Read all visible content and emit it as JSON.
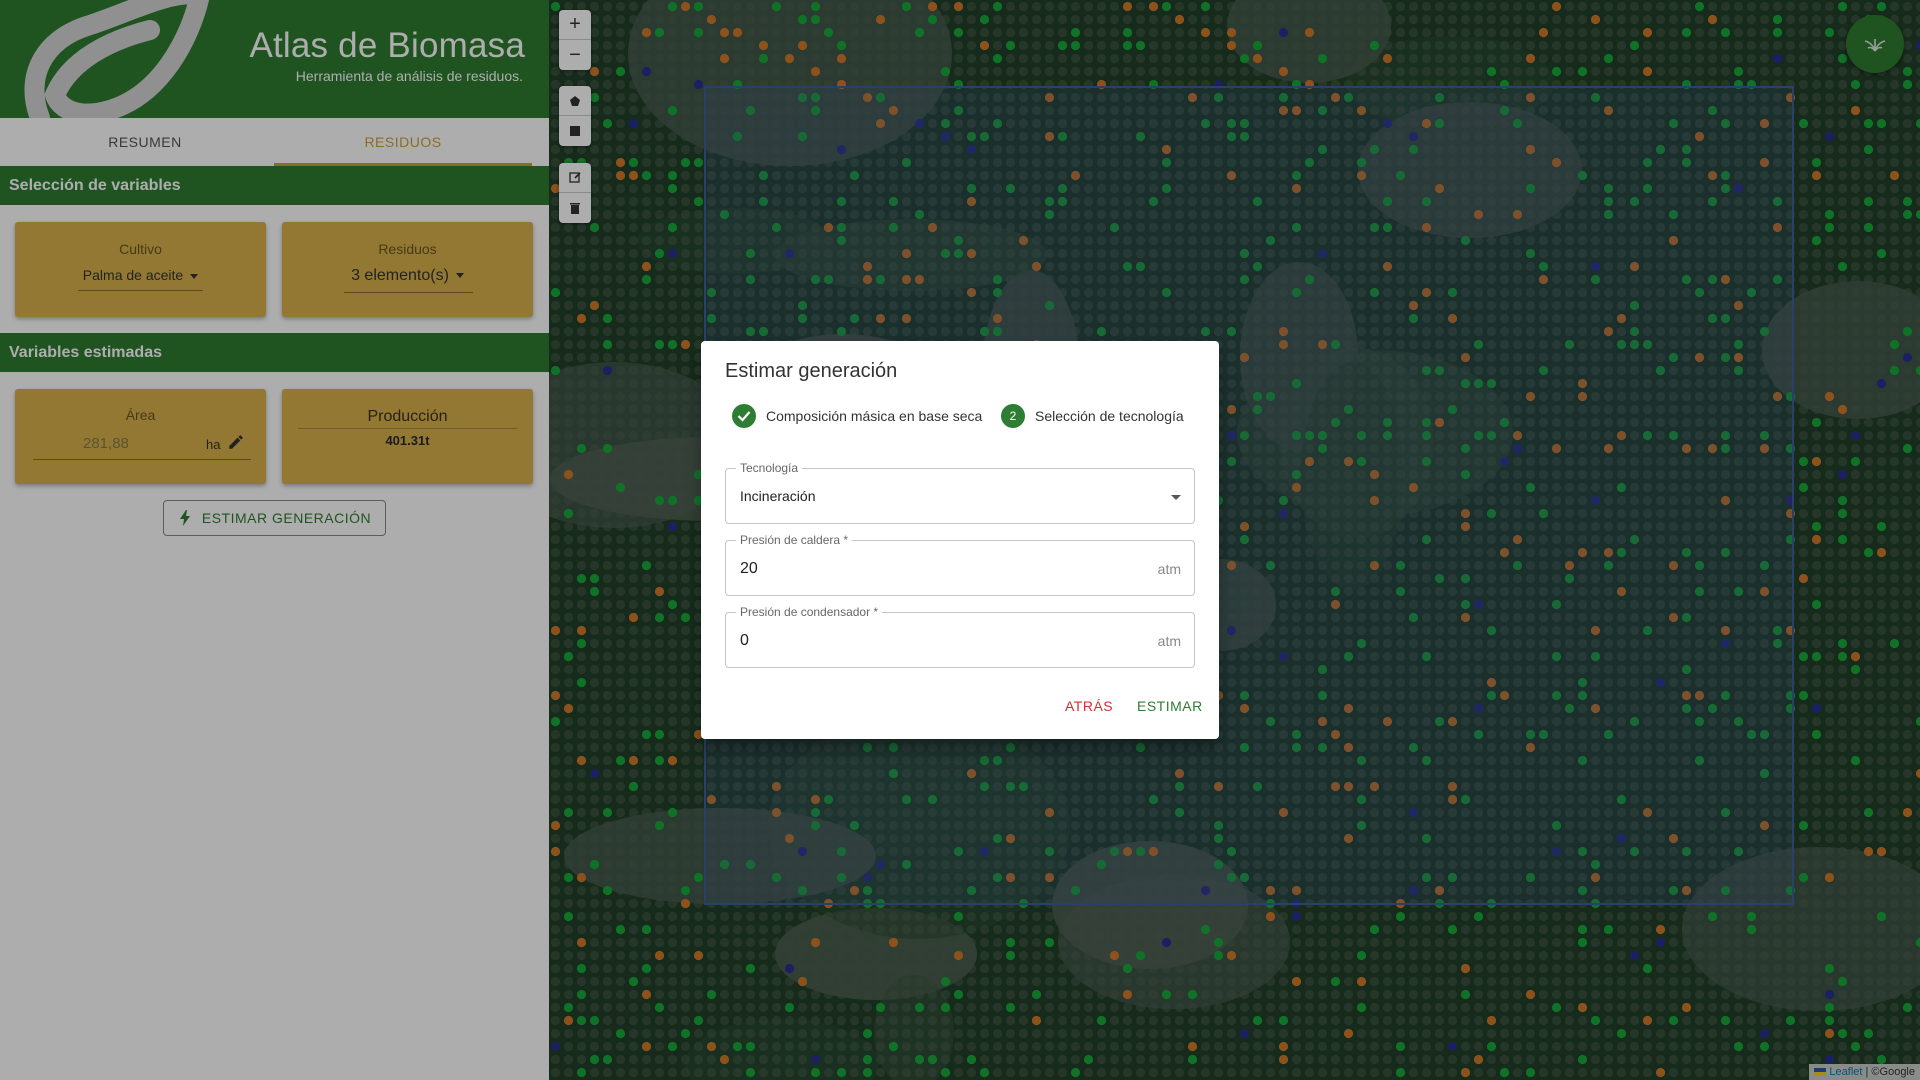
{
  "app": {
    "title": "Atlas de Biomasa",
    "subtitle": "Herramienta de análisis de residuos."
  },
  "tabs": [
    {
      "label": "RESUMEN",
      "active": false
    },
    {
      "label": "RESIDUOS",
      "active": true
    }
  ],
  "sections": {
    "variables": "Selección de variables",
    "estimadas": "Variables estimadas"
  },
  "cultivo": {
    "label": "Cultivo",
    "value": "Palma de aceite"
  },
  "residuos": {
    "label": "Residuos",
    "value": "3 elemento(s)"
  },
  "area": {
    "label": "Área",
    "value": "281,88",
    "unit": "ha"
  },
  "produccion": {
    "label": "Producción",
    "value": "401.31t"
  },
  "estimar_button": "ESTIMAR GENERACIÓN",
  "map": {
    "zoom_in": "+",
    "zoom_out": "−",
    "attribution_leaflet": "Leaflet",
    "attribution_rest": " | ©Google"
  },
  "dialog": {
    "title": "Estimar generación",
    "steps": [
      {
        "number": "1",
        "label": "Composición másica en base seca",
        "completed": true
      },
      {
        "number": "2",
        "label": "Selección de tecnología",
        "completed": false
      }
    ],
    "tecnologia": {
      "label": "Tecnología",
      "value": "Incineración"
    },
    "presion_caldera": {
      "label": "Presión de caldera *",
      "value": "20",
      "unit": "atm"
    },
    "presion_condensador": {
      "label": "Presión de condensador *",
      "value": "0",
      "unit": "atm"
    },
    "back_label": "ATRÁS",
    "submit_label": "ESTIMAR"
  },
  "colors": {
    "primary_green": "#2e7d32",
    "card_gold": "#d8b24c",
    "accent_gold": "#c9a13a",
    "back_red": "#d32f2f"
  }
}
